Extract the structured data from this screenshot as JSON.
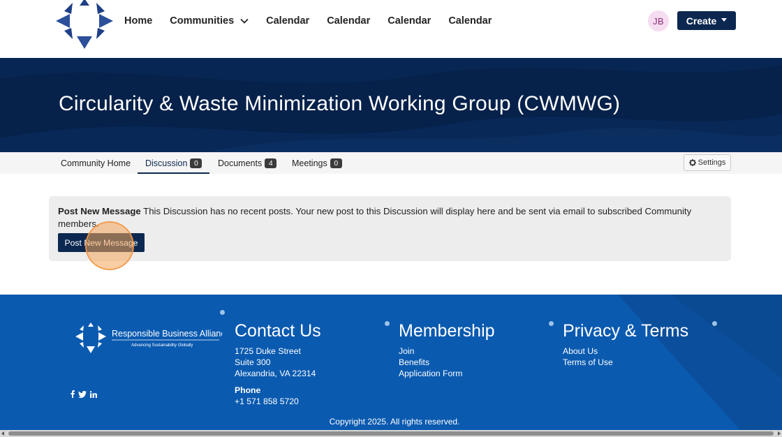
{
  "colors": {
    "navy": "#0c2850",
    "banner": "#06214a",
    "footer": "#0a5ab0",
    "avatar_bg": "#f6dcf0",
    "avatar_text": "#8a2f7c",
    "click_marker": "#f5a65a"
  },
  "header": {
    "logo_icon": "compass-logo-icon",
    "nav": [
      {
        "label": "Home"
      },
      {
        "label": "Communities",
        "icon": "chevron-down-icon"
      },
      {
        "label": "Calendar"
      },
      {
        "label": "Calendar"
      },
      {
        "label": "Calendar"
      },
      {
        "label": "Calendar"
      }
    ],
    "avatar_initials": "JB",
    "create_label": "Create"
  },
  "banner": {
    "title": "Circularity & Waste Minimization Working Group (CWMWG)"
  },
  "tabs": [
    {
      "label": "Community Home"
    },
    {
      "label": "Discussion",
      "count": "0",
      "active": true
    },
    {
      "label": "Documents",
      "count": "4"
    },
    {
      "label": "Meetings",
      "count": "0"
    }
  ],
  "settings_label": "Settings",
  "notice": {
    "heading": "Post New Message",
    "body": " This Discussion has no recent posts. Your new post to this Discussion will display here and be sent via email to subscribed Community members.",
    "button_label": "Post New Message"
  },
  "footer": {
    "logo_name": "Responsible Business Alliance",
    "logo_tagline": "Advancing Sustainability Globally",
    "contact": {
      "title": "Contact Us",
      "address": [
        "1725 Duke Street",
        "Suite 300",
        "Alexandria, VA 22314"
      ],
      "phone_label": "Phone",
      "phone": "+1 571 858 5720"
    },
    "membership": {
      "title": "Membership",
      "links": [
        "Join",
        "Benefits",
        "Application Form"
      ]
    },
    "privacy": {
      "title": "Privacy & Terms",
      "links": [
        "About Us",
        "Terms of Use"
      ]
    },
    "social_icons": [
      "facebook-icon",
      "twitter-icon",
      "linkedin-icon"
    ],
    "copyright": "Copyright 2025. All rights reserved."
  }
}
